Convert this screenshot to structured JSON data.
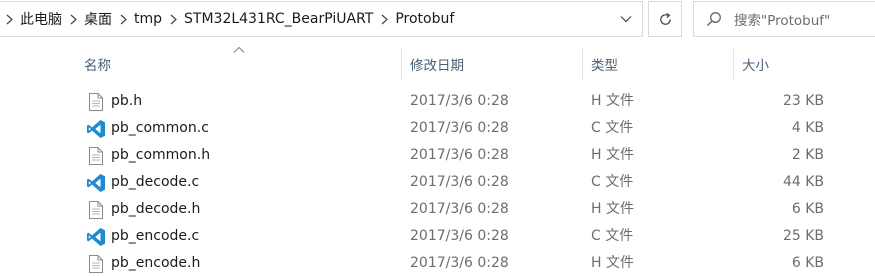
{
  "breadcrumb": [
    "此电脑",
    "桌面",
    "tmp",
    "STM32L431RC_BearPiUART",
    "Protobuf"
  ],
  "search": {
    "placeholder": "搜索\"Protobuf\""
  },
  "columns": {
    "name": "名称",
    "date": "修改日期",
    "type": "类型",
    "size": "大小"
  },
  "files": [
    {
      "name": "pb.h",
      "date": "2017/3/6 0:28",
      "type": "H 文件",
      "size": "23 KB",
      "icon": "header-file-icon"
    },
    {
      "name": "pb_common.c",
      "date": "2017/3/6 0:28",
      "type": "C 文件",
      "size": "4 KB",
      "icon": "vscode-icon"
    },
    {
      "name": "pb_common.h",
      "date": "2017/3/6 0:28",
      "type": "H 文件",
      "size": "2 KB",
      "icon": "header-file-icon"
    },
    {
      "name": "pb_decode.c",
      "date": "2017/3/6 0:28",
      "type": "C 文件",
      "size": "44 KB",
      "icon": "vscode-icon"
    },
    {
      "name": "pb_decode.h",
      "date": "2017/3/6 0:28",
      "type": "H 文件",
      "size": "6 KB",
      "icon": "header-file-icon"
    },
    {
      "name": "pb_encode.c",
      "date": "2017/3/6 0:28",
      "type": "C 文件",
      "size": "25 KB",
      "icon": "vscode-icon"
    },
    {
      "name": "pb_encode.h",
      "date": "2017/3/6 0:28",
      "type": "H 文件",
      "size": "6 KB",
      "icon": "header-file-icon"
    }
  ],
  "colors": {
    "vscode_blue": "#1f8ad2",
    "header_text": "#4c607a",
    "border": "#d9d9d9"
  }
}
